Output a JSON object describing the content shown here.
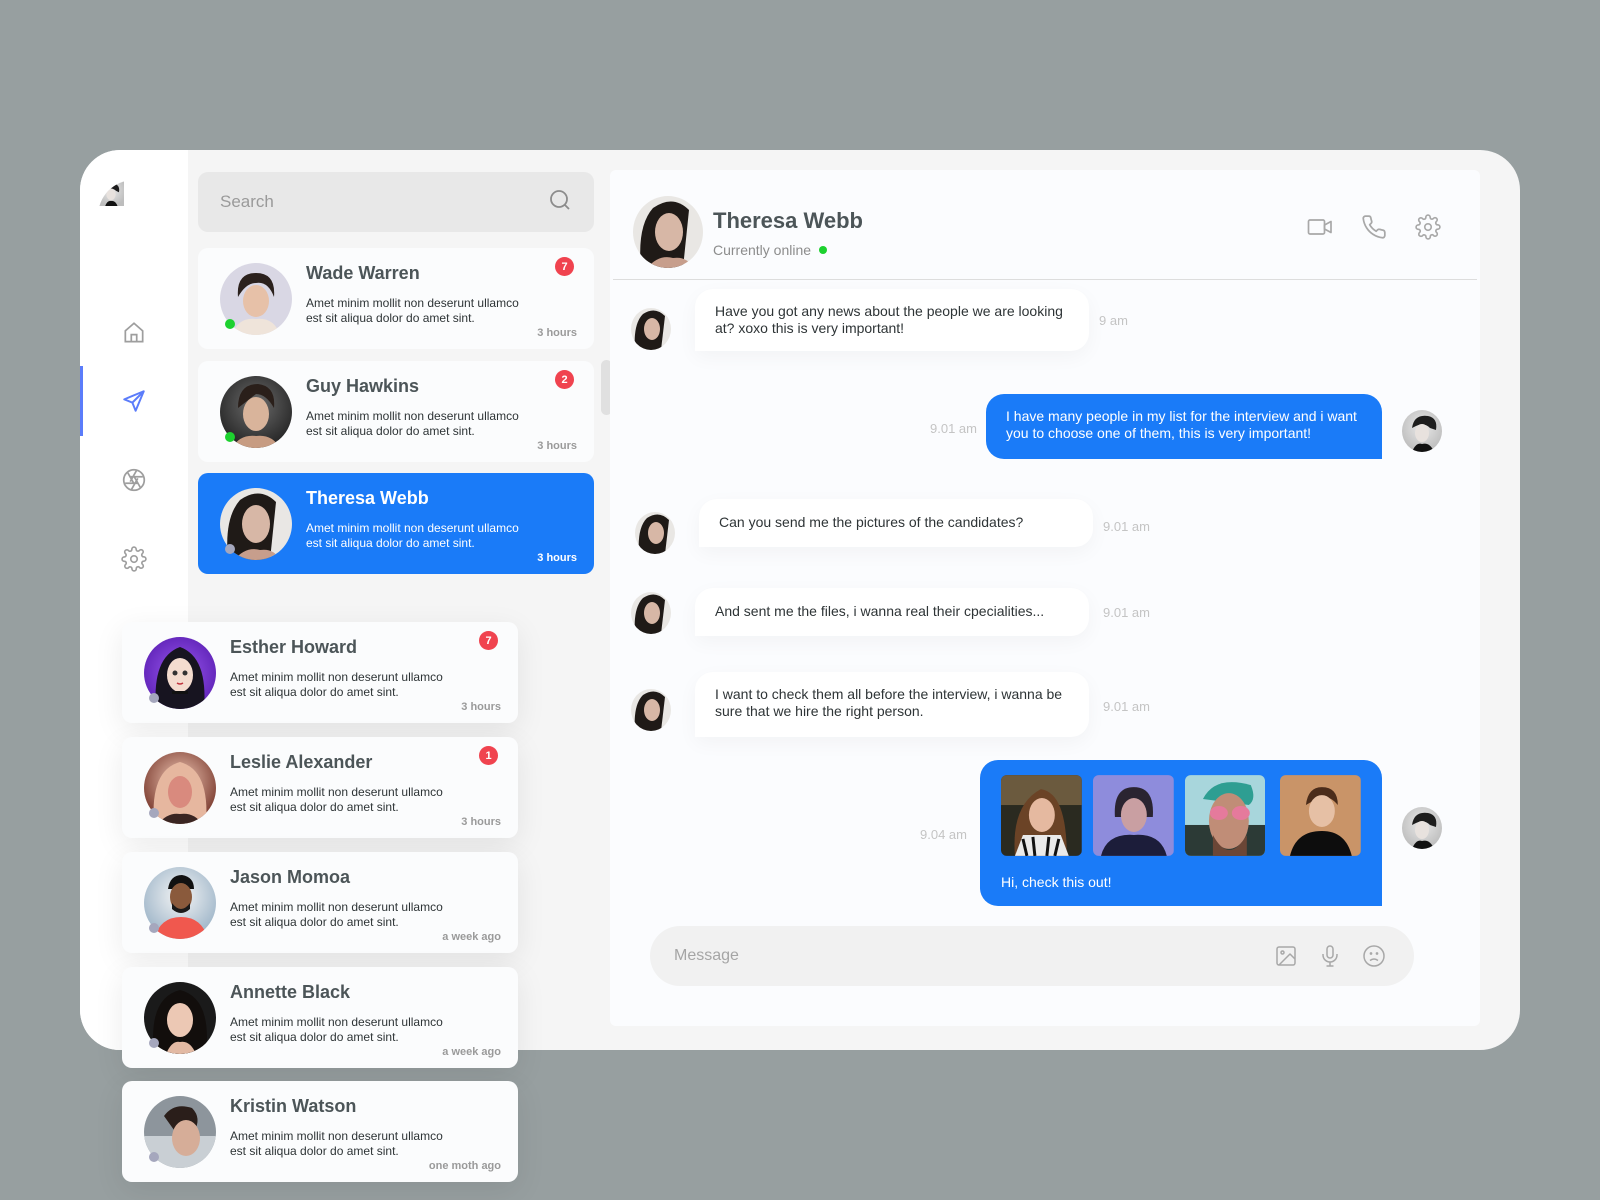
{
  "colors": {
    "accent": "#1A7BF8",
    "nav_active": "#5B7CFA",
    "badge": "#F0434F",
    "online": "#1DD12F",
    "offline": "#A5A7BD",
    "background": "#979FA0"
  },
  "rail": {
    "profile_avatar": "profile-photo",
    "nav": [
      {
        "id": "home",
        "icon": "home-icon",
        "active": false
      },
      {
        "id": "messages",
        "icon": "send-icon",
        "active": true
      },
      {
        "id": "camera",
        "icon": "aperture-icon",
        "active": false
      },
      {
        "id": "settings",
        "icon": "gear-icon",
        "active": false
      }
    ]
  },
  "search": {
    "placeholder": "Search",
    "value": "",
    "icon": "search-icon"
  },
  "conversations": [
    {
      "name": "Wade Warren",
      "preview": "Amet minim mollit non deserunt ullamco est sit aliqua dolor do amet sint.",
      "time": "3 hours",
      "badge": "7",
      "online": true,
      "selected": false
    },
    {
      "name": "Guy Hawkins",
      "preview": "Amet minim mollit non deserunt ullamco est sit aliqua dolor do amet sint.",
      "time": "3 hours",
      "badge": "2",
      "online": true,
      "selected": false
    },
    {
      "name": "Theresa Webb",
      "preview": "Amet minim mollit non deserunt ullamco est sit aliqua dolor do amet sint.",
      "time": "3 hours",
      "badge": "",
      "online": false,
      "selected": true
    },
    {
      "name": "Esther Howard",
      "preview": "Amet minim mollit non deserunt ullamco est sit aliqua dolor do amet sint.",
      "time": "3 hours",
      "badge": "7",
      "online": false,
      "selected": false
    },
    {
      "name": "Leslie Alexander",
      "preview": "Amet minim mollit non deserunt ullamco est sit aliqua dolor do amet sint.",
      "time": "3 hours",
      "badge": "1",
      "online": false,
      "selected": false
    },
    {
      "name": "Jason Momoa",
      "preview": "Amet minim mollit non deserunt ullamco est sit aliqua dolor do amet sint.",
      "time": "a week ago",
      "badge": "",
      "online": false,
      "selected": false
    },
    {
      "name": "Annette Black",
      "preview": "Amet minim mollit non deserunt ullamco est sit aliqua dolor do amet sint.",
      "time": "a week ago",
      "badge": "",
      "online": false,
      "selected": false
    },
    {
      "name": "Kristin Watson",
      "preview": "Amet minim mollit non deserunt ullamco est sit aliqua dolor do amet sint.",
      "time": "one moth ago",
      "badge": "",
      "online": false,
      "selected": false
    }
  ],
  "chat": {
    "contact_name": "Theresa Webb",
    "contact_status": "Currently online",
    "actions": [
      "video-icon",
      "phone-icon",
      "gear-icon"
    ],
    "messages": [
      {
        "direction": "in",
        "text": "Have you got any news about the people we are looking at? xoxo this is very important!",
        "time": "9 am"
      },
      {
        "direction": "out",
        "text": "I have many people in my list for the interview and i want you to choose one of them, this is very important!",
        "time": "9.01 am"
      },
      {
        "direction": "in",
        "text": "Can you send me the pictures of the candidates?",
        "time": "9.01 am"
      },
      {
        "direction": "in",
        "text": "And sent me the files, i wanna real their cpecialities...",
        "time": "9.01 am"
      },
      {
        "direction": "in",
        "text": "I want to check them all before the interview, i wanna be sure that we hire the right person.",
        "time": "9.01 am"
      },
      {
        "direction": "out",
        "text": "Hi, check this out!",
        "time": "9.04 am",
        "attachments": [
          "candidate-photo-1",
          "candidate-photo-2",
          "candidate-photo-3",
          "candidate-photo-4"
        ]
      }
    ]
  },
  "composer": {
    "placeholder": "Message",
    "value": "",
    "icons": [
      "image-icon",
      "microphone-icon",
      "emoji-icon"
    ]
  }
}
